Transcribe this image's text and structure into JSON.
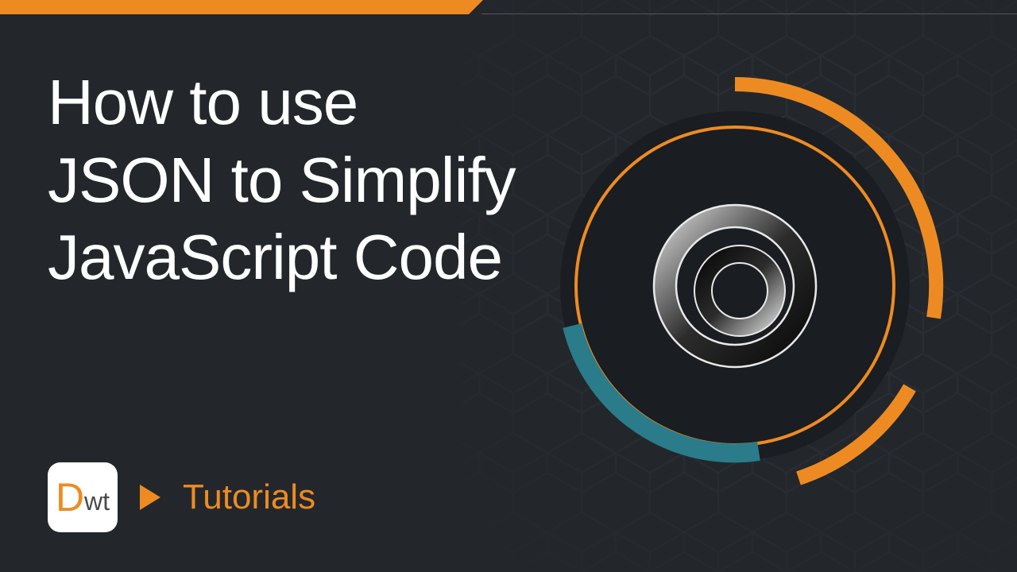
{
  "title_line1": "How to use",
  "title_line2": "JSON to Simplify",
  "title_line3": "JavaScript Code",
  "logo_letter_big": "D",
  "logo_letter_small": "wt",
  "category_label": "Tutorials",
  "colors": {
    "accent_orange": "#ed8b22",
    "accent_teal": "#2a7c8a",
    "background": "#23272c"
  }
}
